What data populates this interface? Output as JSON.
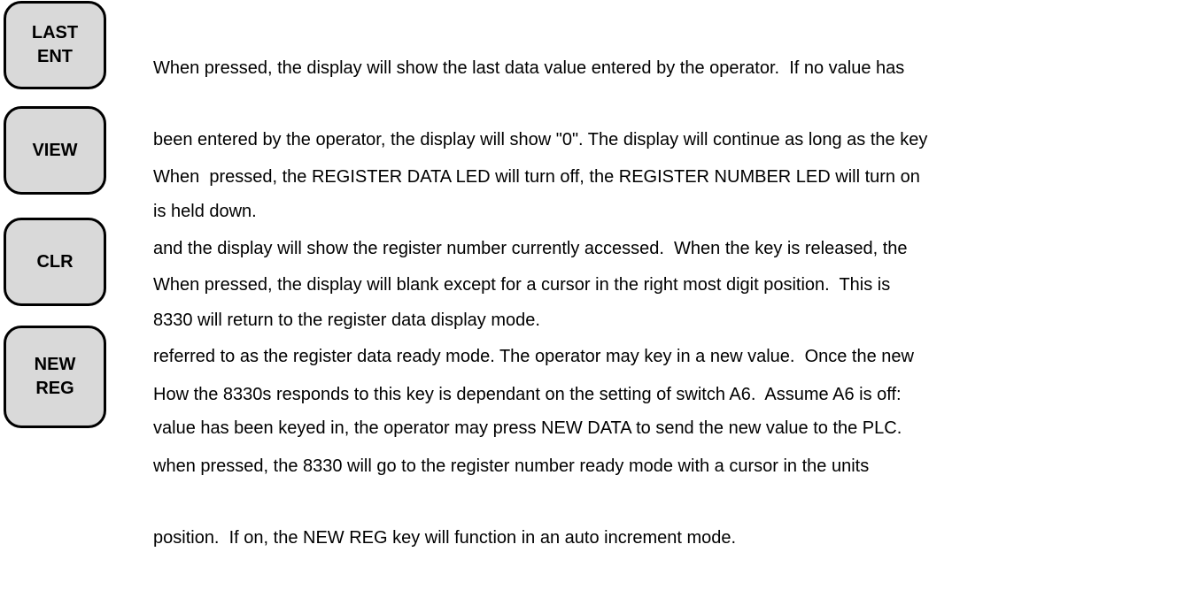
{
  "keys": [
    {
      "label_lines": [
        "LAST",
        "ENT"
      ],
      "description_lines": [
        "When pressed, the display will show the last data value entered by the operator.  If no value has",
        "been entered by the operator, the display will show \"0\". The display will continue as long as the key",
        "is held down."
      ]
    },
    {
      "label_lines": [
        "VIEW"
      ],
      "description_lines": [
        "When  pressed, the REGISTER DATA LED will turn off, the REGISTER NUMBER LED will turn on",
        "and the display will show the register number currently accessed.  When the key is released, the",
        "8330 will return to the register data display mode."
      ]
    },
    {
      "label_lines": [
        "CLR"
      ],
      "description_lines": [
        "When pressed, the display will blank except for a cursor in the right most digit position.  This is",
        "referred to as the register data ready mode. The operator may key in a new value.  Once the new",
        "value has been keyed in, the operator may press NEW DATA to send the new value to the PLC."
      ]
    },
    {
      "label_lines": [
        "NEW",
        "REG"
      ],
      "description_lines": [
        "How the 8330s responds to this key is dependant on the setting of switch A6.  Assume A6 is off:",
        "when pressed, the 8330 will go to the register number ready mode with a cursor in the units",
        "position.  If on, the NEW REG key will function in an auto increment mode."
      ]
    }
  ]
}
